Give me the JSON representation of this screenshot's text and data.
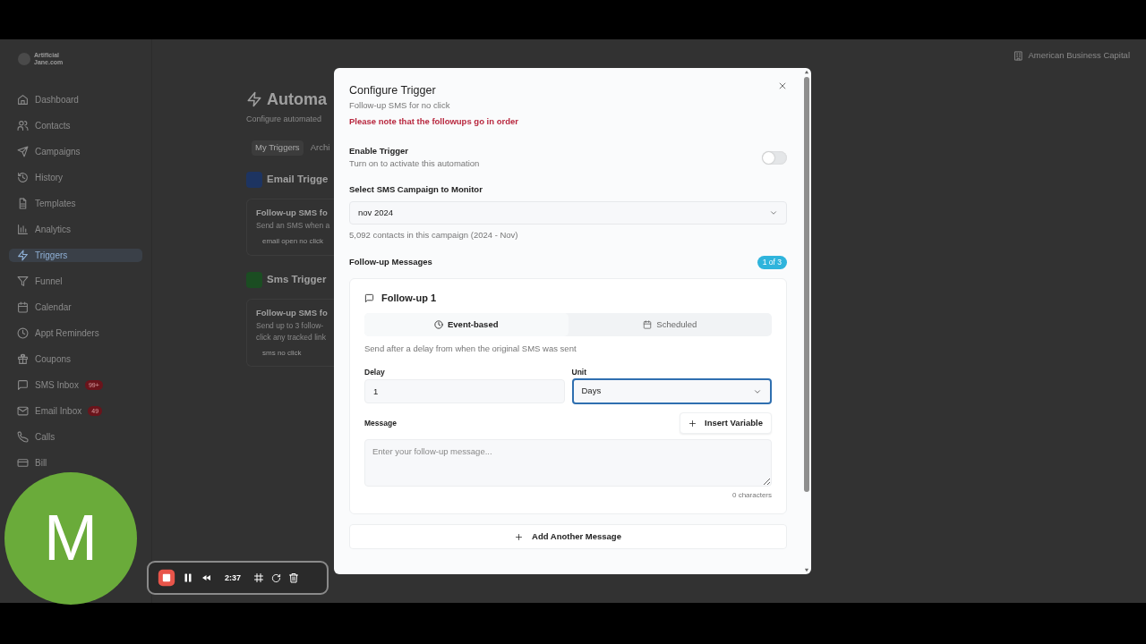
{
  "top_bar": {
    "logo_lines": [
      "Artificial",
      "Jane.com"
    ],
    "company": "American Business Capital"
  },
  "sidebar": {
    "items": [
      {
        "label": "Dashboard",
        "selected": false
      },
      {
        "label": "Contacts",
        "selected": false
      },
      {
        "label": "Campaigns",
        "selected": false
      },
      {
        "label": "History",
        "selected": false
      },
      {
        "label": "Templates",
        "selected": false
      },
      {
        "label": "Analytics",
        "selected": false
      },
      {
        "label": "Triggers",
        "selected": true
      },
      {
        "label": "Funnel",
        "selected": false
      },
      {
        "label": "Calendar",
        "selected": false
      },
      {
        "label": "Appt Reminders",
        "selected": false
      },
      {
        "label": "Coupons",
        "selected": false
      },
      {
        "label": "SMS Inbox",
        "selected": false,
        "badge": "99+"
      },
      {
        "label": "Email Inbox",
        "selected": false,
        "badge": "49"
      },
      {
        "label": "Calls",
        "selected": false
      },
      {
        "label": "Bill",
        "selected": false
      }
    ]
  },
  "page": {
    "title": "Automa",
    "subtitle": "Configure automated",
    "tabs": [
      {
        "label": "My Triggers",
        "selected": true
      },
      {
        "label": "Archi",
        "selected": false
      }
    ],
    "sections": [
      {
        "title": "Email Trigge",
        "color": "#1d3461",
        "cards": [
          {
            "title": "Follow-up SMS fo",
            "description": [
              "Send an SMS when a"
            ],
            "tag": "email open no click"
          }
        ]
      },
      {
        "title": "Sms Trigger",
        "color": "#1b4d22",
        "cards": [
          {
            "title": "Follow-up SMS fo",
            "description": [
              "Send up to 3 follow-",
              "click any tracked link"
            ],
            "tag": "sms no click"
          }
        ]
      }
    ]
  },
  "modal": {
    "title": "Configure Trigger",
    "subtitle": "Follow-up SMS for no click",
    "notice": "Please note that the followups go in order",
    "enable": {
      "label": "Enable Trigger",
      "hint": "Turn on to activate this automation",
      "on": false
    },
    "campaign": {
      "label": "Select SMS Campaign to Monitor",
      "value": "nov 2024",
      "info": "5,092 contacts in this campaign (2024 - Nov)"
    },
    "followups": {
      "label": "Follow-up Messages",
      "counter": "1 of 3",
      "items": [
        {
          "title": "Follow-up 1",
          "modes": [
            {
              "label": "Event-based",
              "selected": true
            },
            {
              "label": "Scheduled",
              "selected": false
            }
          ],
          "hint": "Send after a delay from when the original SMS was sent",
          "delay": {
            "label": "Delay",
            "value": "1"
          },
          "unit": {
            "label": "Unit",
            "value": "Days",
            "focused": true
          },
          "message": {
            "label": "Message",
            "placeholder": "Enter your follow-up message...",
            "insert_button": "Insert Variable",
            "count": "0 characters"
          }
        }
      ],
      "add_button": "Add Another Message"
    }
  },
  "recorder": {
    "avatar_letter": "M",
    "time": "2:37"
  }
}
